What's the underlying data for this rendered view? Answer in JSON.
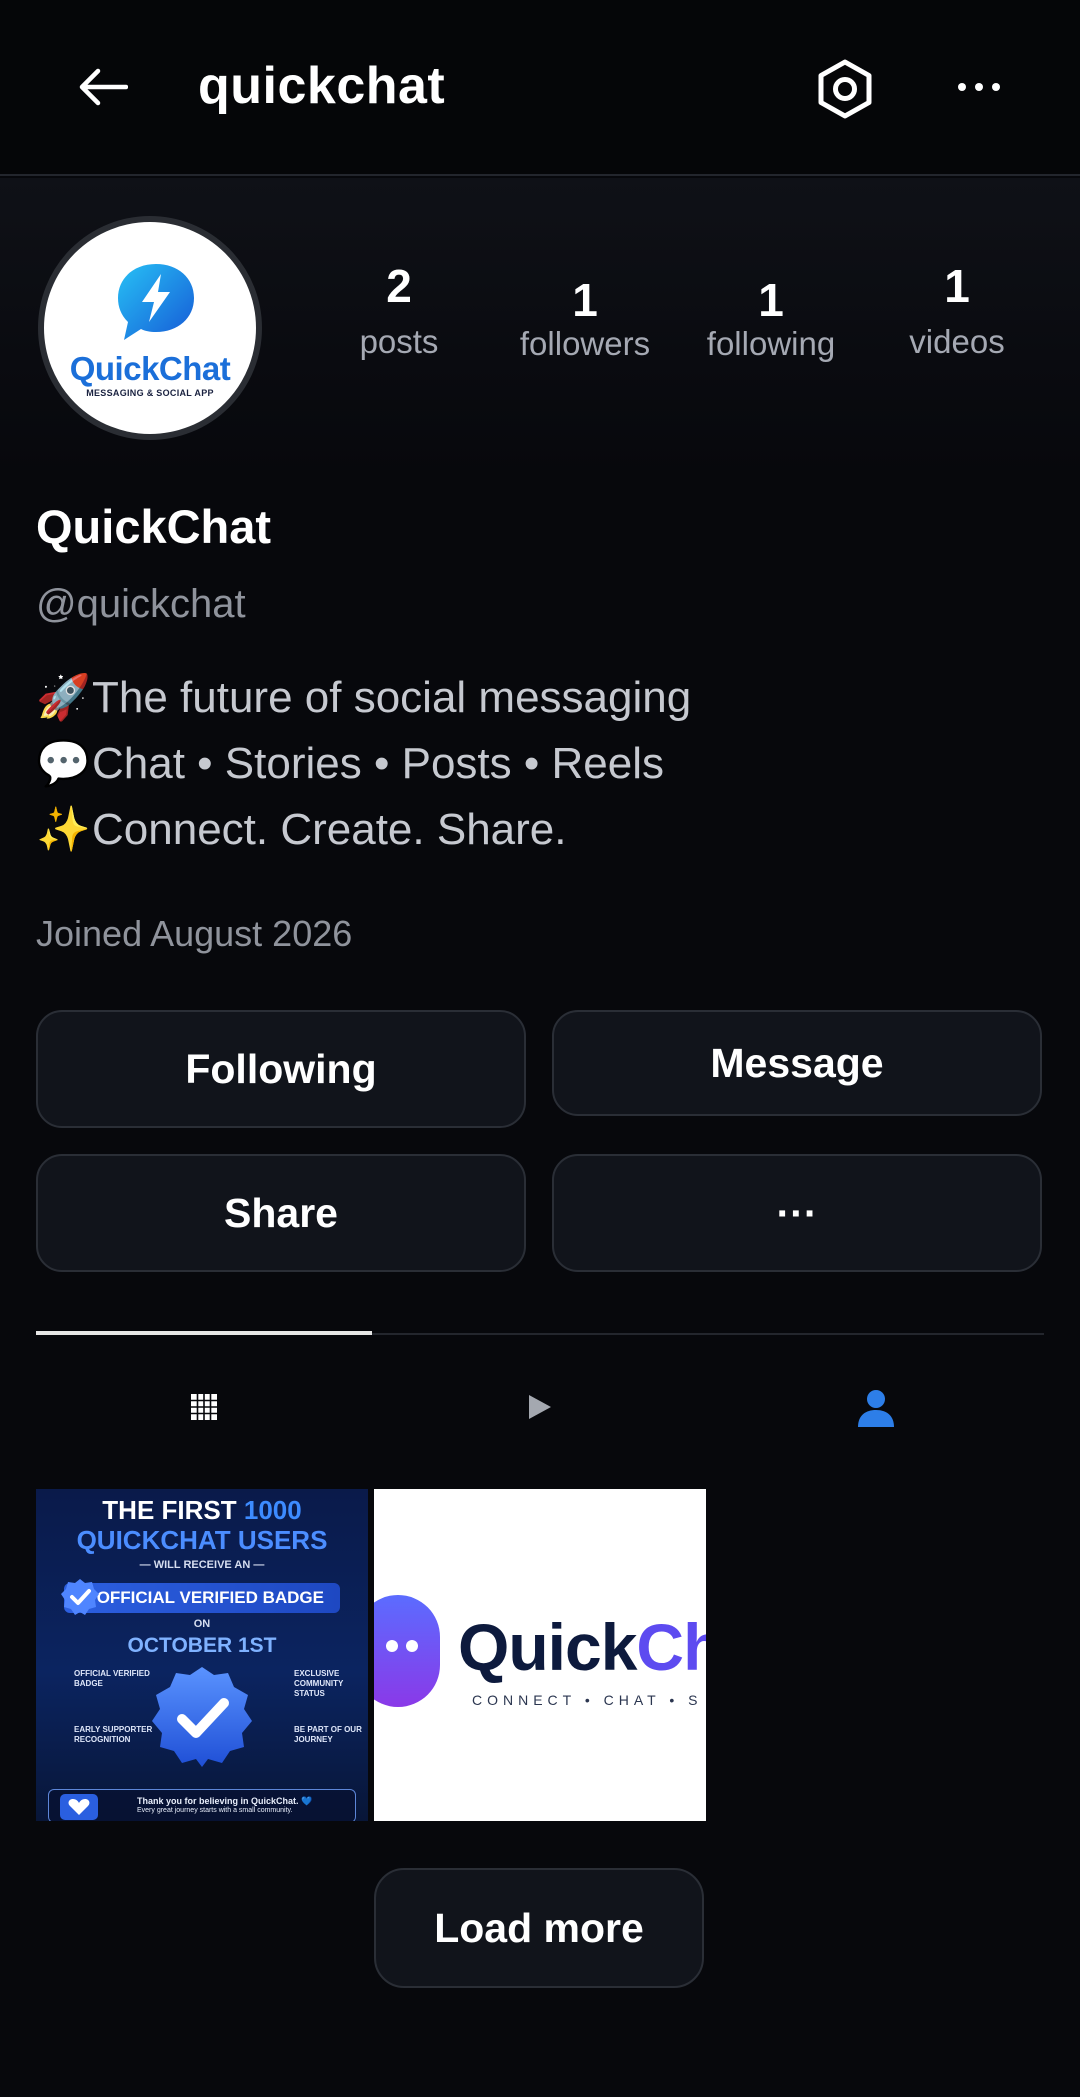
{
  "header": {
    "title": "quickchat",
    "back_icon": "arrow-left-icon",
    "settings_icon": "hexagon-settings-icon",
    "more_icon": "more-horizontal-icon"
  },
  "profile": {
    "avatar": {
      "brand": "QuickChat",
      "tagline": "MESSAGING & SOCIAL APP"
    },
    "stats": [
      {
        "value": "2",
        "label": "posts"
      },
      {
        "value": "1",
        "label": "followers"
      },
      {
        "value": "1",
        "label": "following"
      },
      {
        "value": "1",
        "label": "videos"
      }
    ],
    "display_name": "QuickChat",
    "handle": "@quickchat",
    "bio": [
      {
        "emoji": "🚀",
        "text": "The future of social messaging"
      },
      {
        "emoji": "💬",
        "text": "Chat • Stories • Posts • Reels"
      },
      {
        "emoji": "✨",
        "text": "Connect. Create. Share."
      }
    ],
    "joined": "Joined August 2026"
  },
  "actions": {
    "following": "Following",
    "message": "Message",
    "share": "Share",
    "more": "···"
  },
  "tabs": [
    {
      "icon": "grid-icon",
      "active": true
    },
    {
      "icon": "play-icon",
      "active": false
    },
    {
      "icon": "person-tag-icon",
      "active": false
    }
  ],
  "posts": {
    "post1": {
      "line1_white": "THE FIRST ",
      "line1_blue": "1000",
      "line2": "QUICKCHAT USERS",
      "will_receive": "— WILL RECEIVE AN —",
      "badge": "OFFICIAL VERIFIED BADGE",
      "on": "ON",
      "date": "OCTOBER 1ST",
      "feature1": "OFFICIAL VERIFIED BADGE",
      "feature2": "EXCLUSIVE COMMUNITY STATUS",
      "feature3": "EARLY SUPPORTER RECOGNITION",
      "feature4": "BE PART OF OUR JOURNEY",
      "footer_line1": "Thank you for believing in QuickChat. 💙",
      "footer_line2": "Every great journey starts with a small community."
    },
    "post2": {
      "brand_dark": "Quick",
      "brand_accent": "Ch",
      "tagline": "CONNECT • CHAT • S"
    }
  },
  "load_more": "Load more",
  "colors": {
    "background": "#07080c",
    "button_bg": "#11141b",
    "button_border": "#2a2e36",
    "muted_text": "#8f939c",
    "brand_blue": "#1b6fd9"
  }
}
